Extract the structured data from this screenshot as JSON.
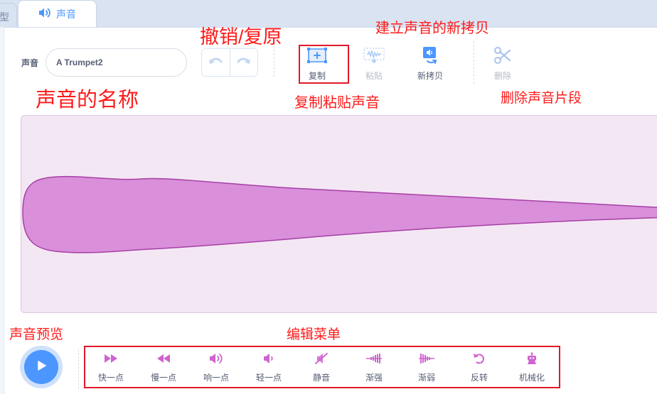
{
  "tabs": {
    "prev_fragment": "型",
    "sound": "声音"
  },
  "editor": {
    "name_label": "声音",
    "name_value": "A Trumpet2"
  },
  "toolbar": {
    "copy": "复制",
    "paste": "粘贴",
    "copy_to_new": "新拷贝",
    "delete": "删除"
  },
  "effects": [
    {
      "label": "快一点",
      "icon": "faster-icon"
    },
    {
      "label": "慢一点",
      "icon": "slower-icon"
    },
    {
      "label": "响一点",
      "icon": "louder-icon"
    },
    {
      "label": "轻一点",
      "icon": "softer-icon"
    },
    {
      "label": "静音",
      "icon": "mute-icon"
    },
    {
      "label": "渐强",
      "icon": "fade-in-icon"
    },
    {
      "label": "渐弱",
      "icon": "fade-out-icon"
    },
    {
      "label": "反转",
      "icon": "reverse-icon"
    },
    {
      "label": "机械化",
      "icon": "robot-icon"
    }
  ],
  "annotations": {
    "undo_redo": "撤销/复原",
    "new_copy": "建立声音的新拷贝",
    "sound_name": "声音的名称",
    "copy_paste": "复制粘贴声音",
    "delete_segment": "删除声音片段",
    "preview": "声音预览",
    "edit_menu": "编辑菜单"
  },
  "colors": {
    "accent": "#4c97ff",
    "effect_icon": "#cf63cf",
    "wave_fill": "#d98fd9",
    "wave_stroke": "#a63fa6",
    "annotation": "#ff1a1a"
  }
}
